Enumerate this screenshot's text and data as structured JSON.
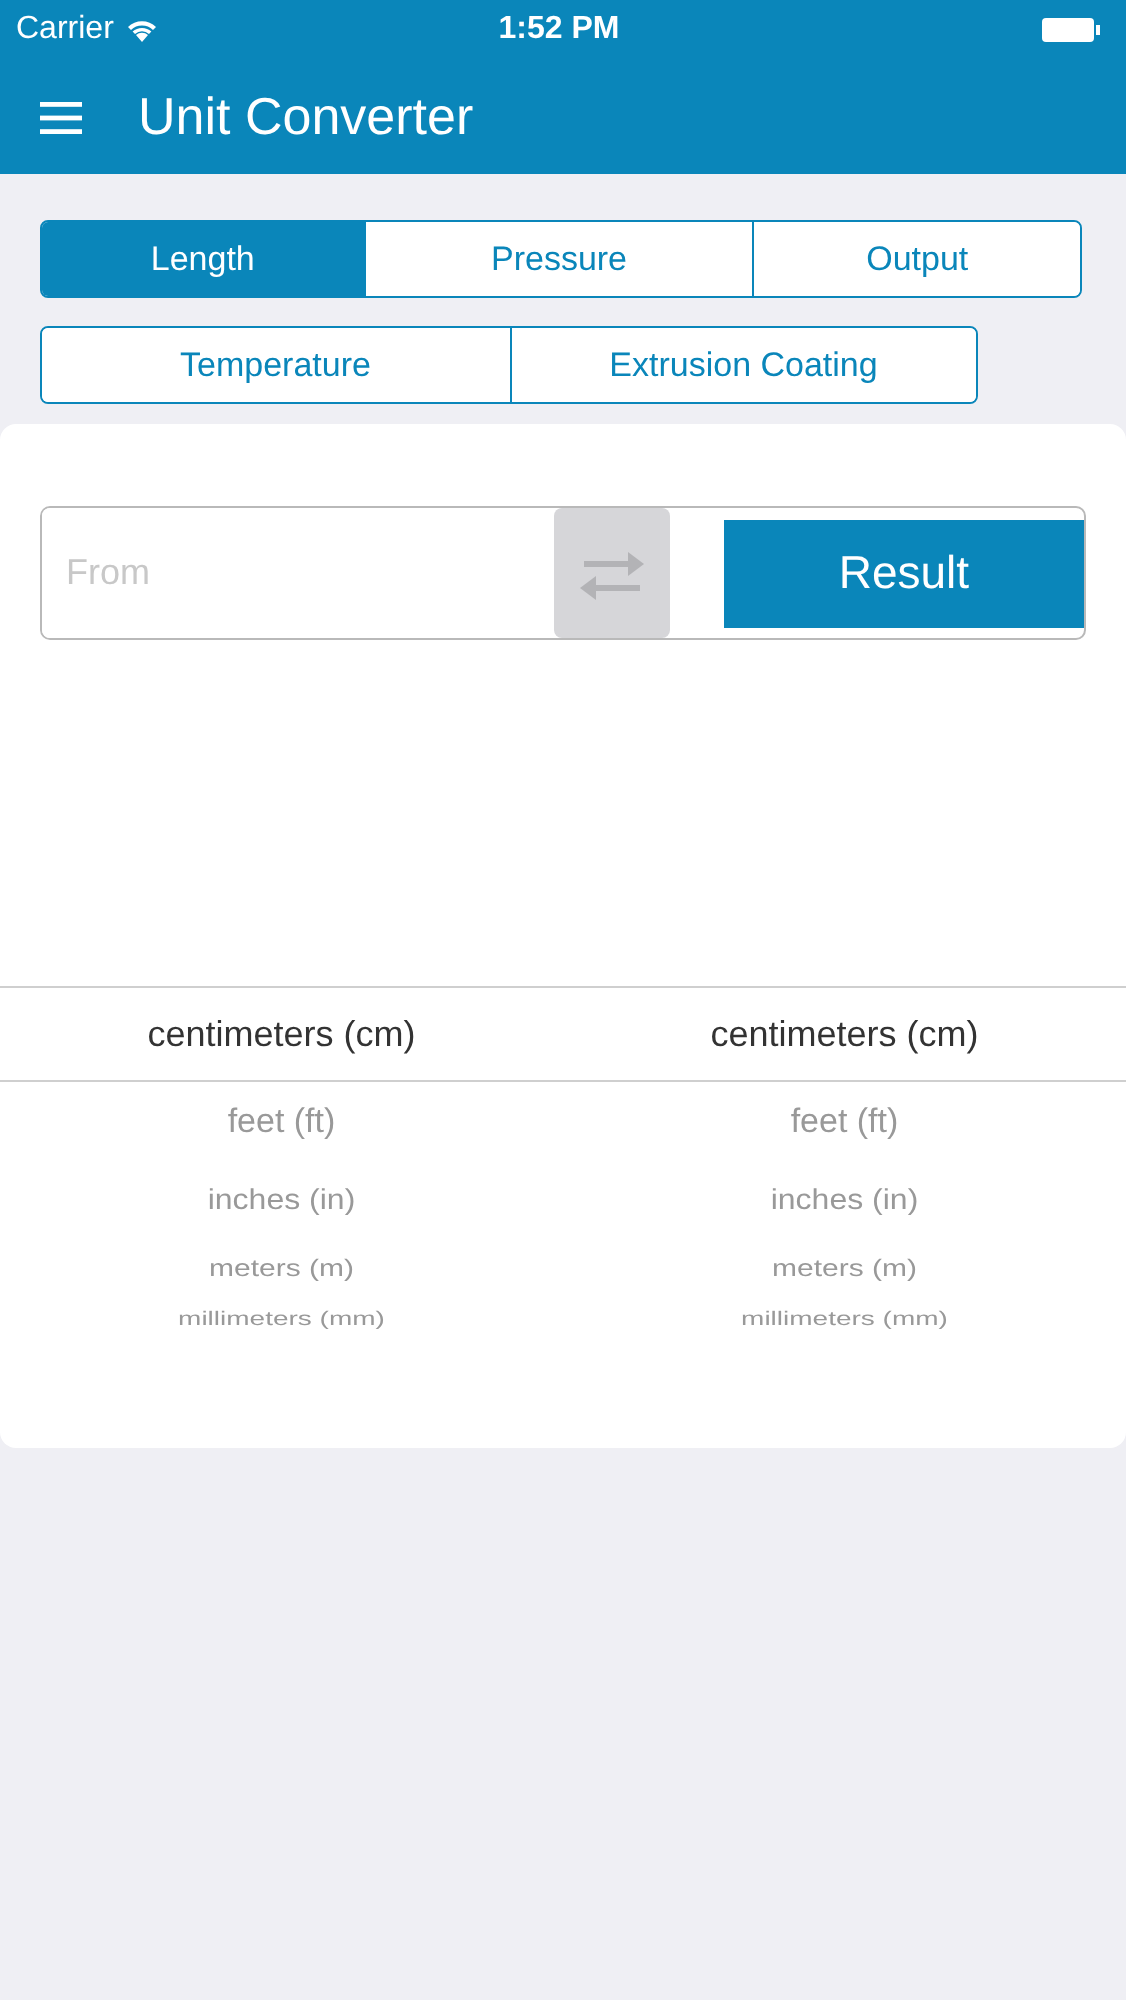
{
  "status_bar": {
    "carrier": "Carrier",
    "time": "1:52 PM"
  },
  "header": {
    "title": "Unit Converter"
  },
  "tab_rows": [
    [
      {
        "label": "Length",
        "selected": true
      },
      {
        "label": "Pressure",
        "selected": false
      },
      {
        "label": "Output",
        "selected": false
      }
    ],
    [
      {
        "label": "Temperature",
        "selected": false
      },
      {
        "label": "Extrusion Coating",
        "selected": false
      }
    ]
  ],
  "converter": {
    "from_placeholder": "From",
    "result_button": "Result"
  },
  "pickers": [
    {
      "selected": "centimeters (cm)",
      "options": [
        "feet (ft)",
        "inches (in)",
        "meters (m)",
        "millimeters (mm)"
      ]
    },
    {
      "selected": "centimeters (cm)",
      "options": [
        "feet (ft)",
        "inches (in)",
        "meters (m)",
        "millimeters (mm)"
      ]
    }
  ]
}
